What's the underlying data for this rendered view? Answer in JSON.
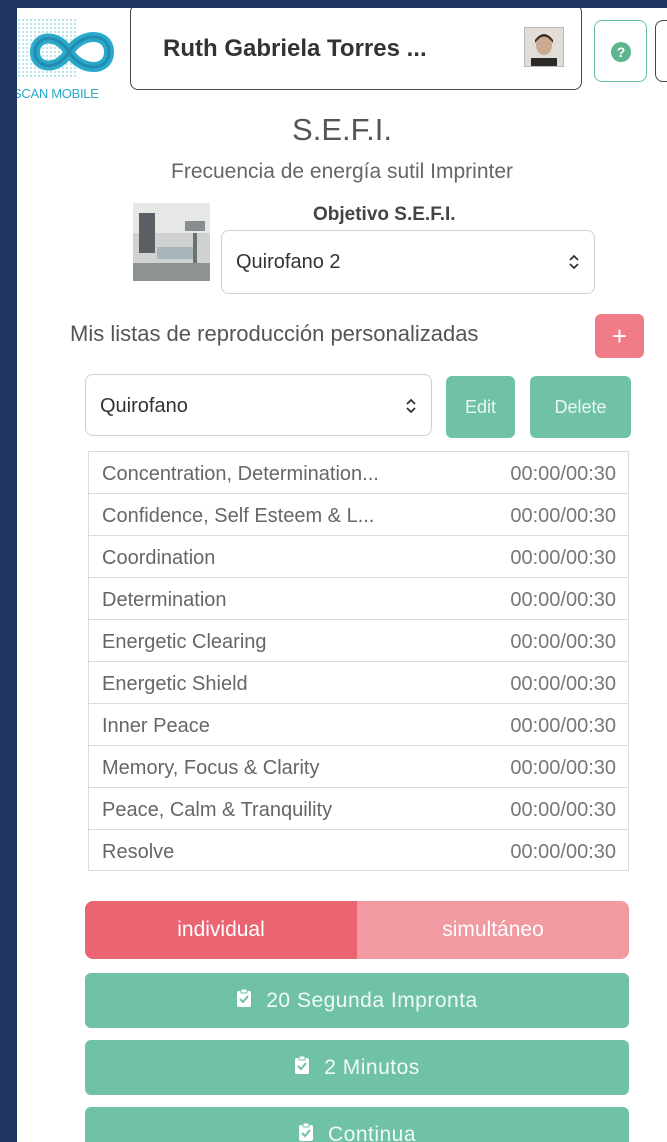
{
  "header": {
    "logo_text": "SCAN MOBILE",
    "user_name": "Ruth Gabriela Torres ...",
    "help_icon": "question-circle-icon"
  },
  "sefi": {
    "title": "S.E.F.I.",
    "subtitle": "Frecuencia de energía sutil Imprinter",
    "objetivo_label": "Objetivo S.E.F.I.",
    "objetivo_value": "Quirofano 2"
  },
  "playlists": {
    "label": "Mis listas de reproducción personalizadas",
    "add_label": "+",
    "selected": "Quirofano",
    "edit_label": "Edit",
    "delete_label": "Delete"
  },
  "tracks": [
    {
      "name": "Concentration, Determination...",
      "time": "00:00/00:30"
    },
    {
      "name": "Confidence, Self Esteem & L...",
      "time": "00:00/00:30"
    },
    {
      "name": "Coordination",
      "time": "00:00/00:30"
    },
    {
      "name": "Determination",
      "time": "00:00/00:30"
    },
    {
      "name": "Energetic Clearing",
      "time": "00:00/00:30"
    },
    {
      "name": "Energetic Shield",
      "time": "00:00/00:30"
    },
    {
      "name": "Inner Peace",
      "time": "00:00/00:30"
    },
    {
      "name": "Memory, Focus & Clarity",
      "time": "00:00/00:30"
    },
    {
      "name": "Peace, Calm & Tranquility",
      "time": "00:00/00:30"
    },
    {
      "name": "Resolve",
      "time": "00:00/00:30"
    }
  ],
  "mode": {
    "individual": "individual",
    "simultaneo": "simultáneo"
  },
  "actions": {
    "seg20": "20 Segunda Impronta",
    "min2": "2 Minutos",
    "continua": "Continua"
  },
  "colors": {
    "frame": "#1f3561",
    "green": "#6fc2a7",
    "pink": "#eb6471",
    "pink_light": "#f29aa2"
  }
}
